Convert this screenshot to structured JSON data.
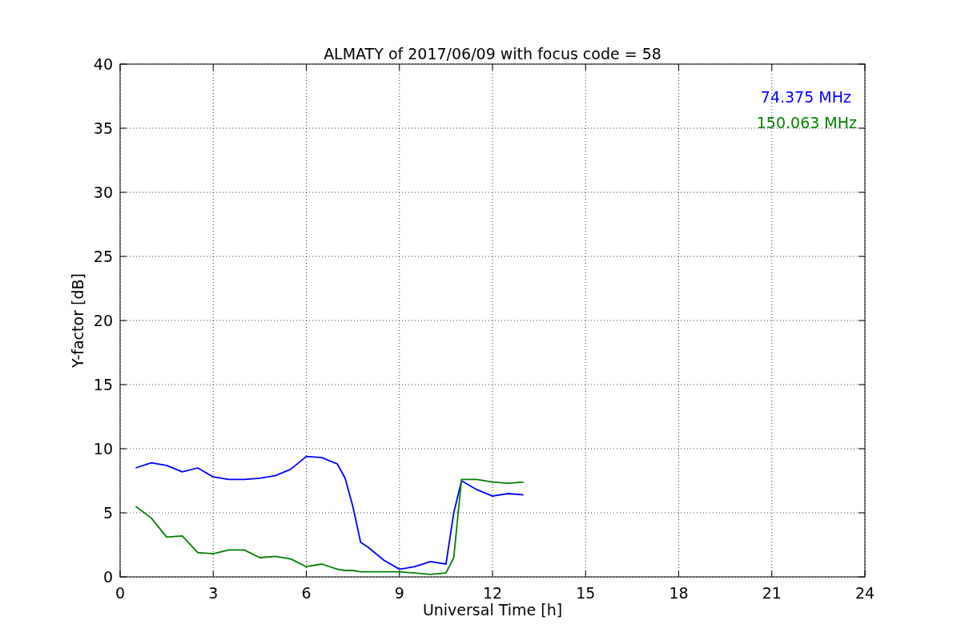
{
  "figure": {
    "chart_data": {
      "type": "line",
      "title": "ALMATY of 2017/06/09 with focus code = 58",
      "xlabel": "Universal Time [h]",
      "ylabel": "Y-factor [dB]",
      "x": [
        0.5,
        1,
        1.5,
        2,
        2.5,
        3,
        3.5,
        4,
        4.5,
        5,
        5.5,
        6,
        6.5,
        7,
        7.25,
        7.5,
        7.75,
        8,
        8.5,
        9,
        9.5,
        10,
        10.5,
        10.75,
        11,
        11.5,
        12,
        12.5,
        13
      ],
      "series": [
        {
          "name": "74.375 MHz",
          "color": "#0000ff",
          "values": [
            8.5,
            8.9,
            8.7,
            8.2,
            8.5,
            7.8,
            7.6,
            7.6,
            7.7,
            7.9,
            8.4,
            9.4,
            9.3,
            8.8,
            7.7,
            5.5,
            2.7,
            2.3,
            1.3,
            0.6,
            0.8,
            1.2,
            1.0,
            5.0,
            7.5,
            6.8,
            6.3,
            6.5,
            6.4
          ]
        },
        {
          "name": "150.063 MHz",
          "color": "#008000",
          "values": [
            5.5,
            4.6,
            3.1,
            3.2,
            1.9,
            1.8,
            2.1,
            2.1,
            1.5,
            1.6,
            1.4,
            0.8,
            1.0,
            0.6,
            0.5,
            0.5,
            0.4,
            0.4,
            0.4,
            0.4,
            0.3,
            0.2,
            0.3,
            1.5,
            7.6,
            7.6,
            7.4,
            7.3,
            7.4
          ]
        }
      ],
      "grid": true,
      "xlim": [
        0,
        24
      ],
      "ylim": [
        0,
        40
      ],
      "xticks": [
        0,
        3,
        6,
        9,
        12,
        15,
        18,
        21,
        24
      ],
      "yticks": [
        0,
        5,
        10,
        15,
        20,
        25,
        30,
        35,
        40
      ]
    }
  }
}
